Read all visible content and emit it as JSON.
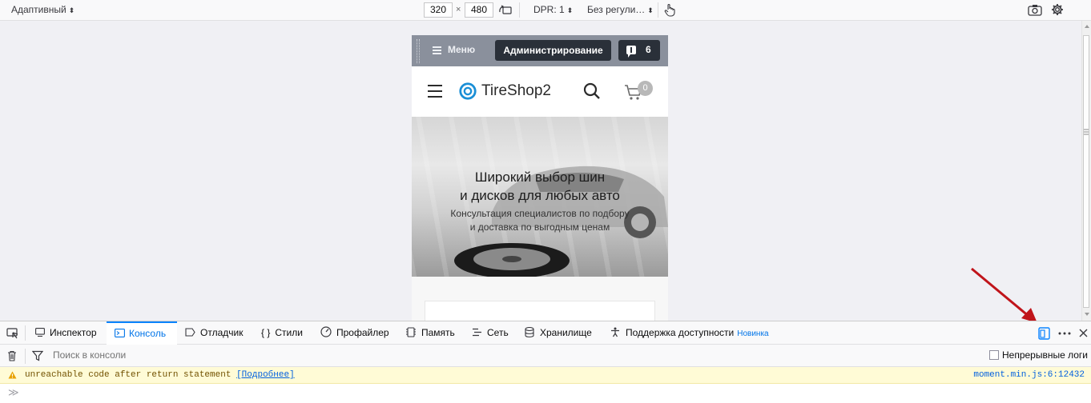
{
  "rdm": {
    "device_label": "Адаптивный",
    "width": "320",
    "times": "×",
    "height": "480",
    "dpr": "DPR: 1",
    "throttle": "Без регули…"
  },
  "admin_bar": {
    "menu_label": "Меню",
    "admin_button": "Администрирование",
    "notifications_count": "6"
  },
  "site": {
    "logo_text": "TireShop2",
    "cart_count": "0",
    "hero_title_line1": "Широкий выбор шин",
    "hero_title_line2": "и дисков для любых авто",
    "hero_sub_line1": "Консультация специалистов по подбору",
    "hero_sub_line2": "и доставка по выгодным ценам"
  },
  "devtools": {
    "tabs": [
      {
        "label": "Инспектор",
        "icon": "inspector-icon"
      },
      {
        "label": "Консоль",
        "icon": "console-icon"
      },
      {
        "label": "Отладчик",
        "icon": "debugger-icon"
      },
      {
        "label": "Стили",
        "icon": "braces-icon"
      },
      {
        "label": "Профайлер",
        "icon": "profiler-icon"
      },
      {
        "label": "Память",
        "icon": "memory-icon"
      },
      {
        "label": "Сеть",
        "icon": "network-icon"
      },
      {
        "label": "Хранилище",
        "icon": "storage-icon"
      },
      {
        "label": "Поддержка доступности",
        "icon": "accessibility-icon"
      }
    ],
    "selected_tab": "Консоль",
    "new_badge": "Новинка",
    "filter_placeholder": "Поиск в консоли",
    "persist_logs": "Непрерывные логи",
    "warning_text": "unreachable code after return statement",
    "warning_link": "[Подробнее]",
    "warning_source": "moment.min.js:6:12432",
    "prompt": "≫"
  },
  "colors": {
    "accent": "#0a84ff",
    "warning_bg": "#fffbd6",
    "admin_bar": "#8a909c",
    "logo_blue": "#1a8fd6"
  }
}
